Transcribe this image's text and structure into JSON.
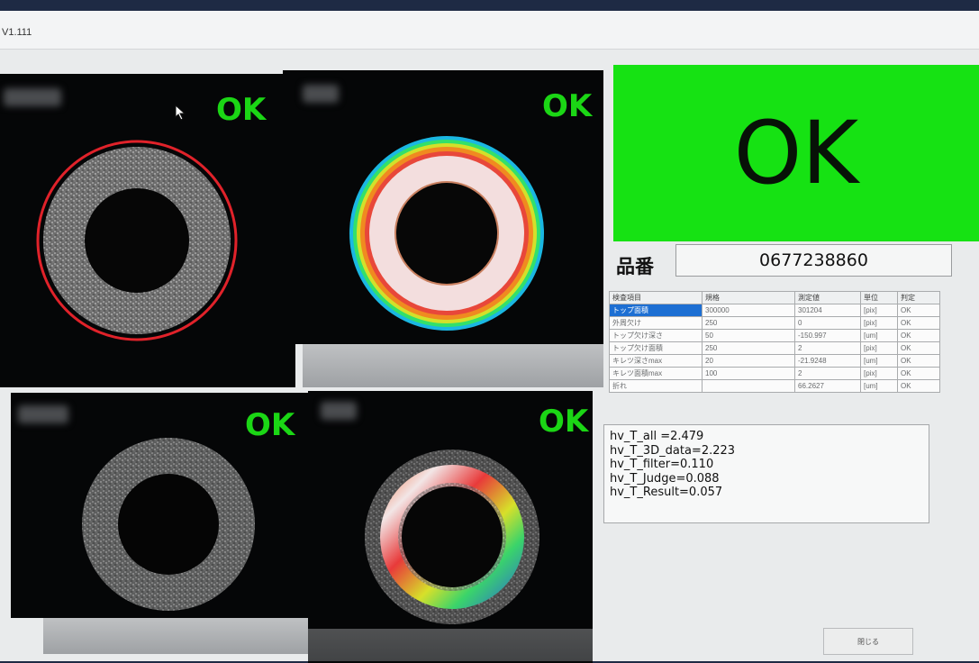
{
  "window": {
    "title": "V1.111"
  },
  "views": [
    {
      "status": "OK"
    },
    {
      "status": "OK"
    },
    {
      "status": "OK"
    },
    {
      "status": "OK"
    }
  ],
  "result": {
    "overall": "OK",
    "color": "#16e213"
  },
  "part_number": {
    "label": "品番",
    "value": "0677238860"
  },
  "inspection_table": {
    "headers": [
      "検査項目",
      "規格",
      "測定値",
      "単位",
      "判定"
    ],
    "rows": [
      [
        "トップ面積",
        "300000",
        "301204",
        "[pix]",
        "OK"
      ],
      [
        "外周欠け",
        "250",
        "0",
        "[pix]",
        "OK"
      ],
      [
        "トップ欠け深さ",
        "50",
        "-150.997",
        "[um]",
        "OK"
      ],
      [
        "トップ欠け面積",
        "250",
        "2",
        "[pix]",
        "OK"
      ],
      [
        "キレツ深さmax",
        "20",
        "-21.9248",
        "[um]",
        "OK"
      ],
      [
        "キレツ面積max",
        "100",
        "2",
        "[pix]",
        "OK"
      ],
      [
        "折れ",
        "",
        "66.2627",
        "[um]",
        "OK"
      ]
    ]
  },
  "timing": [
    "hv_T_all =2.479",
    "hv_T_3D_data=2.223",
    "hv_T_filter=0.110",
    "hv_T_Judge=0.088",
    "hv_T_Result=0.057"
  ],
  "close_button": {
    "label": "閉じる"
  },
  "icons": {
    "cursor": "mouse-pointer-icon"
  }
}
